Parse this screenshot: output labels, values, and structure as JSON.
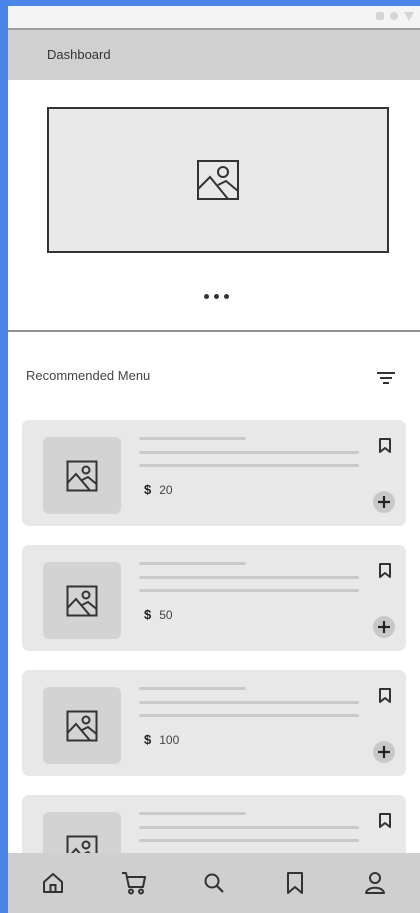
{
  "header": {
    "title": "Dashboard"
  },
  "banner": {
    "icon": "image-placeholder-icon",
    "pagination": "more-dots-icon"
  },
  "section": {
    "title": "Recommended Menu",
    "filter_icon": "filter-icon"
  },
  "menu_items": [
    {
      "currency": "$",
      "price": "20"
    },
    {
      "currency": "$",
      "price": "50"
    },
    {
      "currency": "$",
      "price": "100"
    },
    {
      "currency": "",
      "price": ""
    }
  ],
  "bottom_nav": [
    {
      "icon": "home-icon"
    },
    {
      "icon": "cart-icon"
    },
    {
      "icon": "search-icon"
    },
    {
      "icon": "bookmark-icon"
    },
    {
      "icon": "profile-icon"
    }
  ],
  "colors": {
    "background": "#4a86e8",
    "card": "#e8e8e8",
    "header": "#d0d0d0",
    "nav": "#cfcfcf"
  }
}
